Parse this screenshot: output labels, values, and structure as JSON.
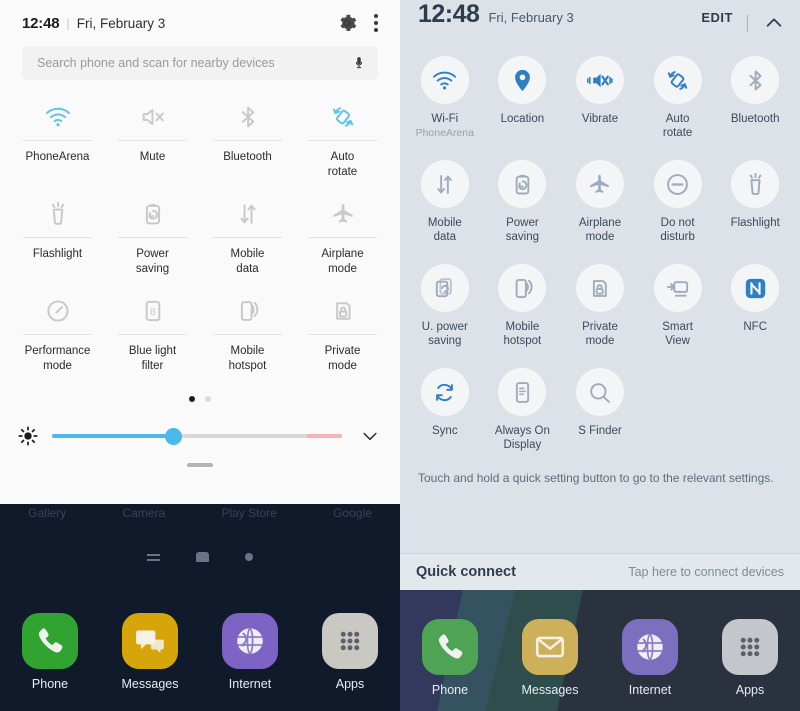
{
  "left_panel": {
    "status": {
      "time": "12:48",
      "separator": "|",
      "date": "Fri, February 3",
      "gear_icon": "gear-icon",
      "kebab_icon": "more-options-icon"
    },
    "search": {
      "placeholder": "Search phone and scan for nearby devices",
      "mic_icon": "microphone-icon"
    },
    "toggles": [
      {
        "label": "PhoneArena",
        "icon": "wifi-icon",
        "active": true
      },
      {
        "label": "Mute",
        "icon": "mute-icon",
        "active": false
      },
      {
        "label": "Bluetooth",
        "icon": "bluetooth-icon",
        "active": false
      },
      {
        "label": "Auto\nrotate",
        "icon": "auto-rotate-icon",
        "active": true
      },
      {
        "label": "Flashlight",
        "icon": "flashlight-icon",
        "active": false
      },
      {
        "label": "Power\nsaving",
        "icon": "power-saving-icon",
        "active": false
      },
      {
        "label": "Mobile\ndata",
        "icon": "mobile-data-icon",
        "active": false
      },
      {
        "label": "Airplane\nmode",
        "icon": "airplane-mode-icon",
        "active": false
      },
      {
        "label": "Performance\nmode",
        "icon": "performance-mode-icon",
        "active": false
      },
      {
        "label": "Blue light\nfilter",
        "icon": "blue-light-filter-icon",
        "active": false
      },
      {
        "label": "Mobile\nhotspot",
        "icon": "mobile-hotspot-icon",
        "active": false
      },
      {
        "label": "Private\nmode",
        "icon": "private-mode-icon",
        "active": false
      }
    ],
    "pagination": {
      "total": 2,
      "active_index": 0
    },
    "brightness": {
      "icon": "brightness-icon",
      "value_percent": 42,
      "expand_icon": "chevron-down-icon"
    },
    "home": {
      "ghost_labels": [
        "Gallery",
        "Camera",
        "Play Store",
        "Google"
      ],
      "nav": {
        "recent_icon": "recents-icon",
        "home_icon": "home-icon",
        "back_icon": "back-icon"
      },
      "dock": [
        {
          "label": "Phone",
          "icon": "phone-icon",
          "color": "#31a331"
        },
        {
          "label": "Messages",
          "icon": "messages-icon",
          "color": "#d5a509"
        },
        {
          "label": "Internet",
          "icon": "internet-icon",
          "color": "#7d63c4"
        },
        {
          "label": "Apps",
          "icon": "apps-grid-icon",
          "color": "#c9c8c3"
        }
      ]
    }
  },
  "right_panel": {
    "status": {
      "time": "12:48",
      "date": "Fri, February 3",
      "edit_label": "EDIT",
      "collapse_icon": "chevron-up-icon"
    },
    "toggles": [
      {
        "label": "Wi-Fi",
        "sub": "PhoneArena",
        "icon": "wifi-icon",
        "active": true
      },
      {
        "label": "Location",
        "sub": "",
        "icon": "location-pin-icon",
        "active": true
      },
      {
        "label": "Vibrate",
        "sub": "",
        "icon": "vibrate-icon",
        "active": true
      },
      {
        "label": "Auto\nrotate",
        "sub": "",
        "icon": "auto-rotate-icon",
        "active": true
      },
      {
        "label": "Bluetooth",
        "sub": "",
        "icon": "bluetooth-icon",
        "active": false
      },
      {
        "label": "Mobile\ndata",
        "sub": "",
        "icon": "mobile-data-icon",
        "active": false
      },
      {
        "label": "Power\nsaving",
        "sub": "",
        "icon": "power-saving-icon",
        "active": false
      },
      {
        "label": "Airplane\nmode",
        "sub": "",
        "icon": "airplane-mode-icon",
        "active": false
      },
      {
        "label": "Do not\ndisturb",
        "sub": "",
        "icon": "do-not-disturb-icon",
        "active": false
      },
      {
        "label": "Flashlight",
        "sub": "",
        "icon": "flashlight-icon",
        "active": false
      },
      {
        "label": "U. power\nsaving",
        "sub": "",
        "icon": "ultra-power-saving-icon",
        "active": false
      },
      {
        "label": "Mobile\nhotspot",
        "sub": "",
        "icon": "mobile-hotspot-icon",
        "active": false
      },
      {
        "label": "Private\nmode",
        "sub": "",
        "icon": "private-mode-icon",
        "active": false
      },
      {
        "label": "Smart\nView",
        "sub": "",
        "icon": "smart-view-icon",
        "active": false
      },
      {
        "label": "NFC",
        "sub": "",
        "icon": "nfc-icon",
        "active": true
      },
      {
        "label": "Sync",
        "sub": "",
        "icon": "sync-icon",
        "active": true
      },
      {
        "label": "Always On\nDisplay",
        "sub": "",
        "icon": "always-on-display-icon",
        "active": false
      },
      {
        "label": "S Finder",
        "sub": "",
        "icon": "search-icon",
        "active": false
      }
    ],
    "hint": "Touch and hold a quick setting button to go to the relevant settings.",
    "quick_connect": {
      "title": "Quick connect",
      "subtitle": "Tap here to connect devices"
    },
    "home": {
      "dock": [
        {
          "label": "Phone",
          "icon": "phone-icon",
          "color": "#4fa355"
        },
        {
          "label": "Messages",
          "icon": "mail-icon",
          "color": "#cdb05a"
        },
        {
          "label": "Internet",
          "icon": "internet-icon",
          "color": "#7d6fc0"
        },
        {
          "label": "Apps",
          "icon": "apps-grid-icon",
          "color": "#c3c7cb"
        }
      ]
    }
  },
  "colors": {
    "accent_blue": "#4ab8e8",
    "right_accent": "#2f7fc4",
    "right_inactive": "#9fadbb",
    "right_bg": "#dde2e8"
  }
}
